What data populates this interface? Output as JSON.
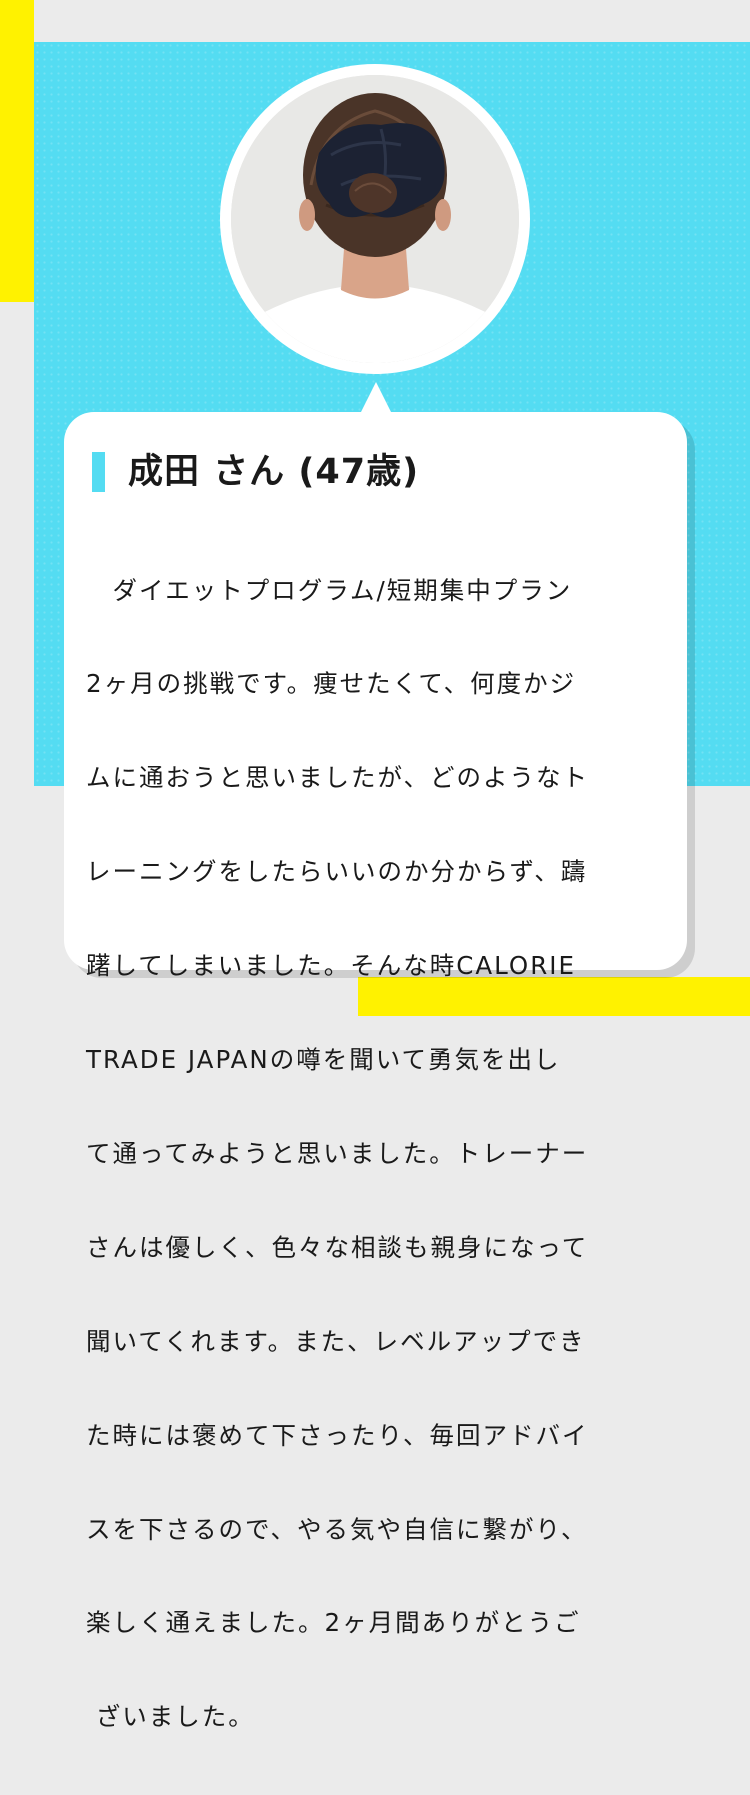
{
  "colors": {
    "accent_cyan": "#54dcf2",
    "accent_yellow": "#fff200",
    "background": "#ebebeb",
    "card": "#ffffff",
    "text": "#1a1a1a"
  },
  "profile": {
    "photo_alt": "back of head with dark scrunchie hair bun",
    "name": "成田 さん (47歳)"
  },
  "testimonial": {
    "lines": [
      "　ダイエットプログラム/短期集中プラン",
      "2ヶ月の挑戦です。痩せたくて、何度かジ",
      "ムに通おうと思いましたが、どのようなト",
      "レーニングをしたらいいのか分からず、躊",
      "躇してしまいました。そんな時CALORIE",
      "TRADE JAPANの噂を聞いて勇気を出し",
      "て通ってみようと思いました。トレーナー",
      "さんは優しく、色々な相談も親身になって",
      "聞いてくれます。また、レベルアップでき",
      "た時には褒めて下さったり、毎回アドバイ",
      "スを下さるので、やる気や自信に繋がり、",
      "楽しく通えました。2ヶ月間ありがとうご",
      " ざいました。"
    ]
  }
}
